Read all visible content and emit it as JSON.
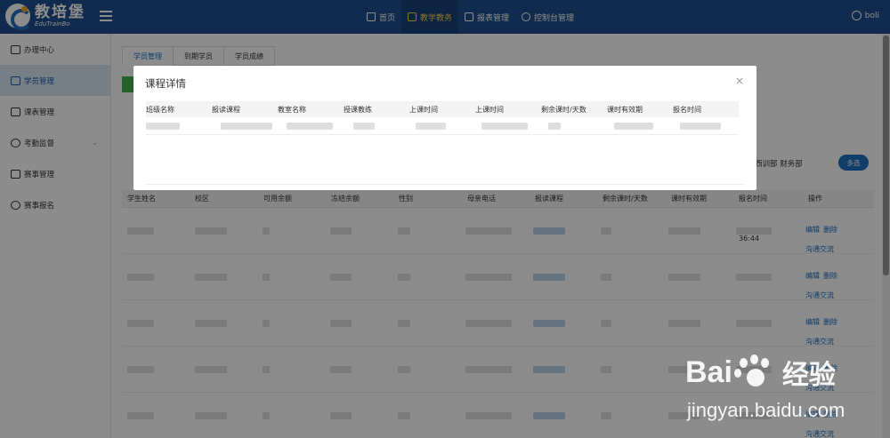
{
  "header": {
    "logo_cn": "教培堡",
    "logo_en": "EduTrainBo",
    "nav": [
      {
        "label": "首页",
        "icon": "home-icon",
        "active": false
      },
      {
        "label": "教学教务",
        "icon": "calendar-icon",
        "active": true
      },
      {
        "label": "报表管理",
        "icon": "bar-chart-icon",
        "active": false
      },
      {
        "label": "控制台管理",
        "icon": "gear-icon",
        "active": false
      }
    ],
    "user": "boli"
  },
  "sidebar": {
    "items": [
      {
        "label": "办理中心",
        "icon": "monitor-icon"
      },
      {
        "label": "学员管理",
        "icon": "student-icon"
      },
      {
        "label": "课表管理",
        "icon": "calendar-icon"
      },
      {
        "label": "考勤监督",
        "icon": "eye-icon",
        "has_arrow": true
      },
      {
        "label": "赛事管理",
        "icon": "trophy-icon"
      },
      {
        "label": "赛事报名",
        "icon": "info-icon"
      }
    ],
    "active_index": 1
  },
  "main": {
    "tabs": [
      "学员管理",
      "到期学员",
      "学员成绩"
    ],
    "filter_text": "西训部   财务部",
    "multi_button": "多选",
    "columns": [
      "学生姓名",
      "校区",
      "可用余额",
      "冻结余额",
      "性别",
      "母亲电话",
      "报读课程",
      "剩余课时/天数",
      "课时有效期",
      "报名时间",
      "操作"
    ],
    "row_ops": {
      "edit": "编辑",
      "delete": "删除",
      "communicate": "沟通交流"
    },
    "first_time_tail": "36:44"
  },
  "modal": {
    "title": "课程详情",
    "close": "×",
    "columns": [
      "班级名称",
      "报读课程",
      "教室名称",
      "授课教练",
      "上课时间",
      "上课时间",
      "剩余课时/天数",
      "课时有效期",
      "报名时间"
    ]
  },
  "watermark": {
    "brand_left": "Bai",
    "brand_cn": "经验",
    "url": "jingyan.baidu.com"
  },
  "colors": {
    "topbar": "#1e4f8c",
    "active_nav_text": "#ffd24d",
    "accent": "#1e6fc2",
    "green": "#3cb34a"
  }
}
